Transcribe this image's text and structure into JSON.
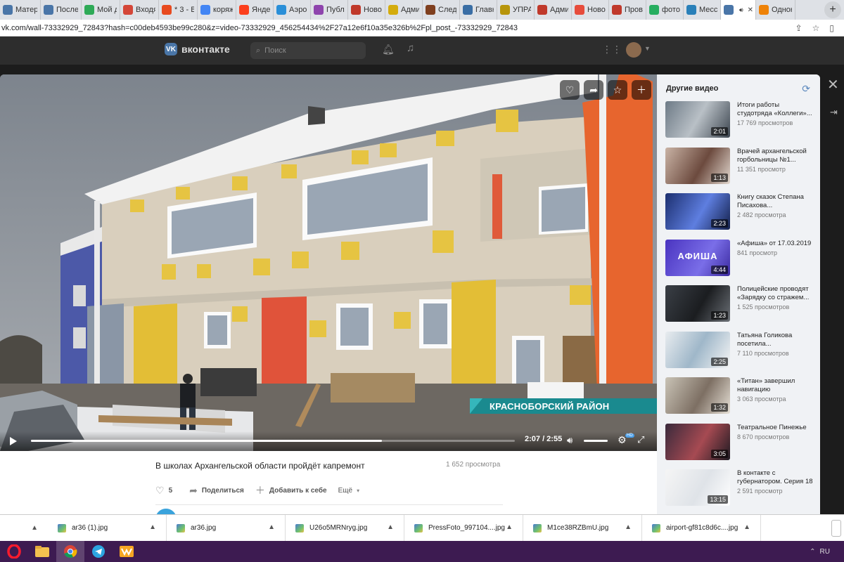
{
  "browser": {
    "tabs": [
      {
        "label": "Матер",
        "favicon": "vk",
        "color": "#4a76a8"
      },
      {
        "label": "После",
        "favicon": "vk",
        "color": "#4a76a8"
      },
      {
        "label": "Мой д",
        "favicon": "drive",
        "color": "#2eaa57"
      },
      {
        "label": "Входя",
        "favicon": "gmail",
        "color": "#d44638"
      },
      {
        "label": "* 3 - В",
        "favicon": "mail",
        "color": "#e84a1f"
      },
      {
        "label": "коряж",
        "favicon": "google",
        "color": "#4285f4"
      },
      {
        "label": "Яндек",
        "favicon": "yandex",
        "color": "#fc3f1d"
      },
      {
        "label": "Аэроп",
        "favicon": "world",
        "color": "#2a8fd8"
      },
      {
        "label": "Публи",
        "favicon": "pub",
        "color": "#8e44ad"
      },
      {
        "label": "Ново",
        "favicon": "news",
        "color": "#c0392b"
      },
      {
        "label": "Адми",
        "favicon": "admin",
        "color": "#d4ac0d"
      },
      {
        "label": "Следс",
        "favicon": "sk",
        "color": "#7f3f1f"
      },
      {
        "label": "Главн",
        "favicon": "gear",
        "color": "#3a6ea5"
      },
      {
        "label": "УПРА",
        "favicon": "upr",
        "color": "#b7950b"
      },
      {
        "label": "Адми",
        "favicon": "admin",
        "color": "#c0392b"
      },
      {
        "label": "Новос",
        "favicon": "news",
        "color": "#e74c3c"
      },
      {
        "label": "Прове",
        "favicon": "check",
        "color": "#c0392b"
      },
      {
        "label": "фото",
        "favicon": "photo",
        "color": "#27ae60"
      },
      {
        "label": "Мессе",
        "favicon": "msg",
        "color": "#2980b9"
      },
      {
        "label": "",
        "favicon": "vk",
        "color": "#4a76a8",
        "active": true
      },
      {
        "label": "Однок",
        "favicon": "ok",
        "color": "#ee8208"
      }
    ],
    "url": "vk.com/wall-73332929_72843?hash=c00deb4593be99c280&z=video-73332929_456254434%2F27a12e6f10a35e326b%2Fpl_post_-73332929_72843",
    "new_tab_label": "+"
  },
  "vk": {
    "logo_text": "вконтакте",
    "logo_letter": "VK",
    "search_placeholder": "Поиск"
  },
  "video": {
    "title": "В школах Архангельской области пройдёт капремонт",
    "views": "1 652 просмотра",
    "lower_third": "КРАСНОБОРСКИЙ РАЙОН",
    "time": "2:07 / 2:55",
    "progress_fraction": 0.726,
    "likes": "5",
    "share_label": "Поделиться",
    "add_label": "Добавить к себе",
    "more_label": "Ещё"
  },
  "sidebar": {
    "heading": "Другие видео",
    "items": [
      {
        "title": "Итоги работы студотряда «Коллеги»...",
        "views": "17 769 просмотров",
        "duration": "2:01"
      },
      {
        "title": "Врачей архангельской горбольницы №1...",
        "views": "11 351 просмотр",
        "duration": "1:13"
      },
      {
        "title": "Книгу сказок Степана Писахова...",
        "views": "2 482 просмотра",
        "duration": "2:23"
      },
      {
        "title": "«Афиша» от 17.03.2019",
        "views": "841 просмотр",
        "duration": "4:44",
        "thumb_text": "АФИША"
      },
      {
        "title": "Полицейские проводят «Зарядку со стражем...",
        "views": "1 525 просмотров",
        "duration": "1:23"
      },
      {
        "title": "Татьяна Голикова посетила...",
        "views": "7 110 просмотров",
        "duration": "2:25"
      },
      {
        "title": "«Титан» завершил навигацию",
        "views": "3 063 просмотра",
        "duration": "1:32"
      },
      {
        "title": "Театральное Пинежье",
        "views": "8 670 просмотров",
        "duration": "3:05"
      },
      {
        "title": "В контакте с губернатором. Серия 18",
        "views": "2 591 просмотр",
        "duration": "13:15"
      }
    ]
  },
  "downloads": [
    {
      "name": "ar36 (1).jpg"
    },
    {
      "name": "ar36.jpg"
    },
    {
      "name": "U26o5MRNryg.jpg"
    },
    {
      "name": "PressFoto_997104....jpg"
    },
    {
      "name": "M1ce38RZBmU.jpg"
    },
    {
      "name": "airport-gf81c8d6c....jpg"
    }
  ],
  "taskbar": {
    "apps": [
      "opera-icon",
      "folder-icon",
      "chrome-icon",
      "telegram-icon",
      "winamp-icon"
    ],
    "language": "RU"
  }
}
